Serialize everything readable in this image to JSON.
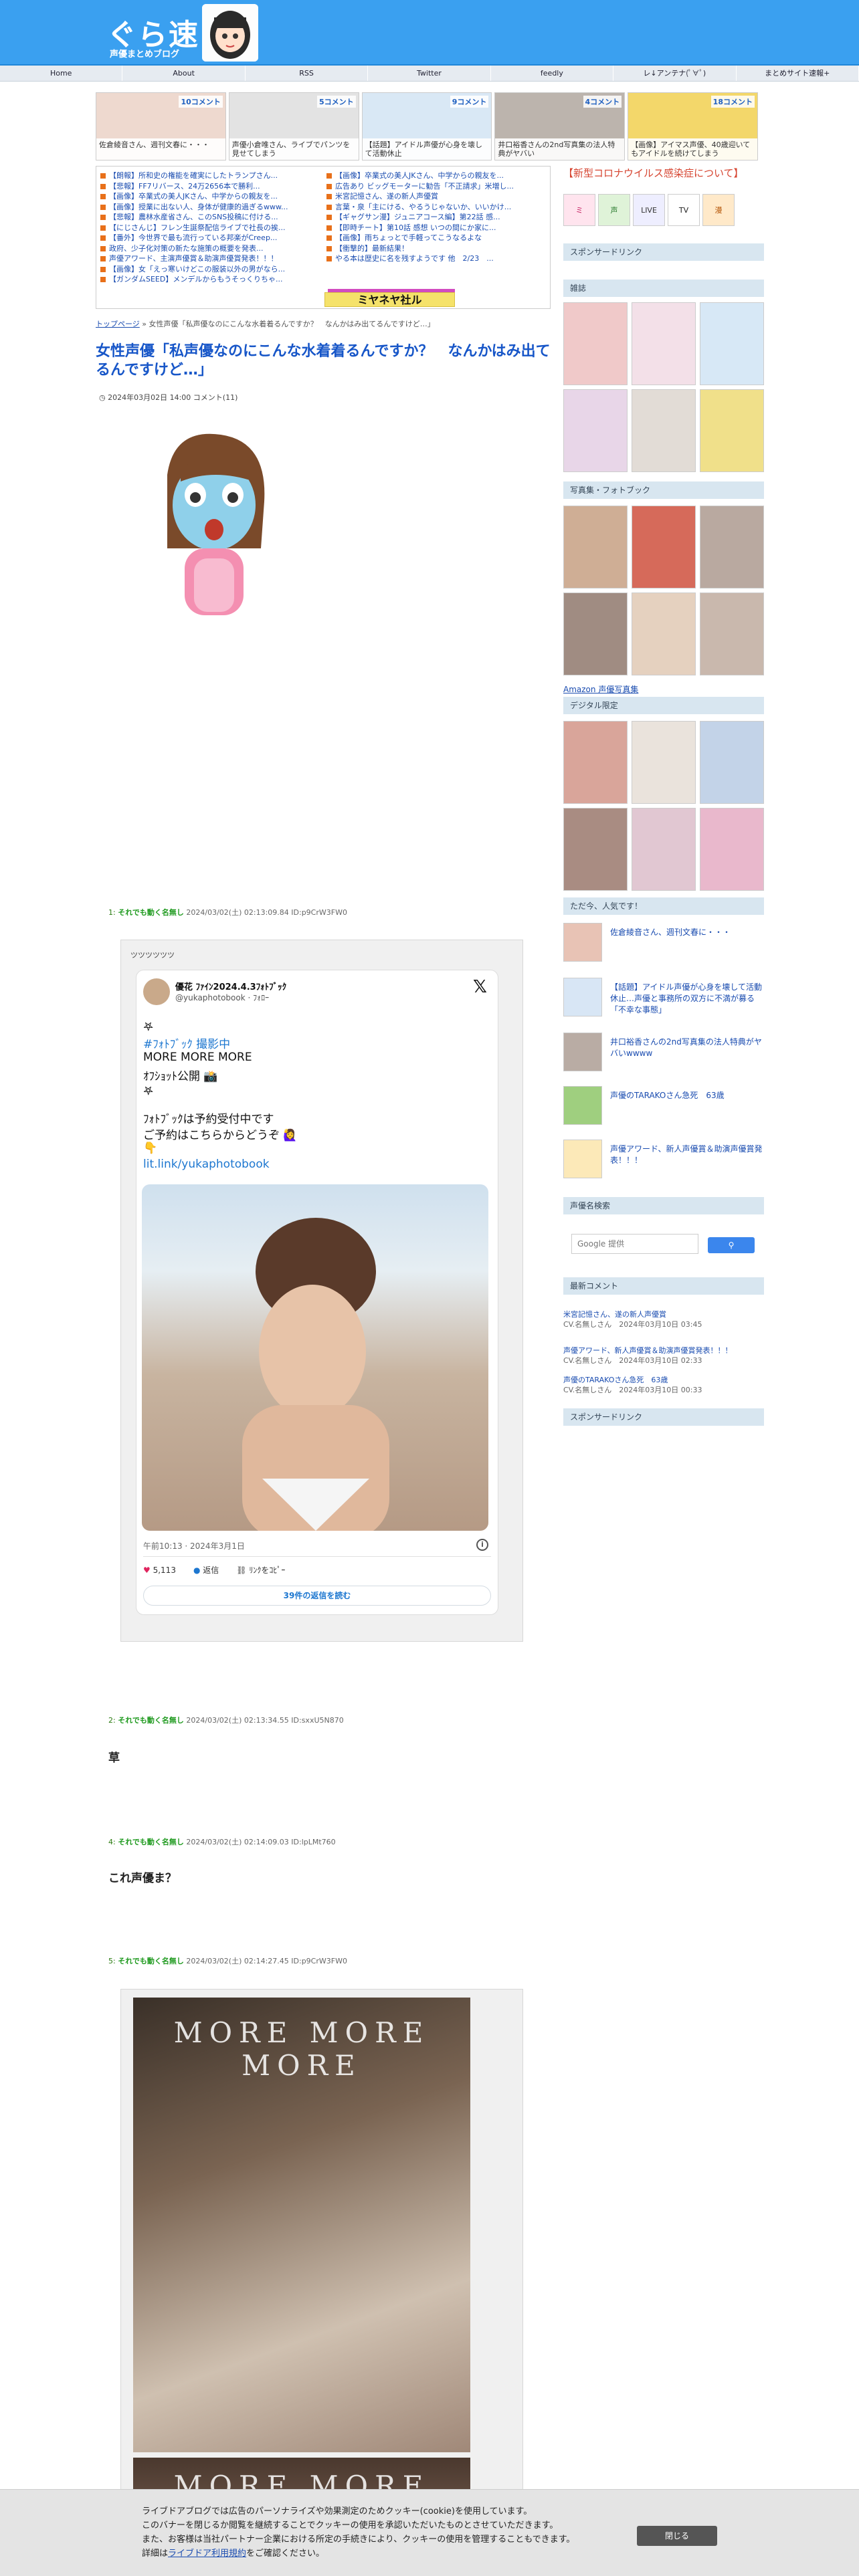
{
  "header": {
    "logo_main": "ぐら速",
    "logo_sub": "声優まとめブログ",
    "nav": [
      "Home",
      "About",
      "RSS",
      "Twitter",
      "feedly",
      "レ↓アンテナ(ﾟ∀ﾟ)",
      "まとめサイト速報+"
    ]
  },
  "top_thumbs": [
    {
      "comments": "10コメント",
      "caption": "佐倉綾音さん、週刊文春に・・・"
    },
    {
      "comments": "5コメント",
      "caption": "声優小倉唯さん、ライブでパンツを見せてしまう"
    },
    {
      "comments": "9コメント",
      "caption": "【話題】アイドル声優が心身を壊して活動休止"
    },
    {
      "comments": "4コメント",
      "caption": "井口裕香さんの2nd写真集の法人特典がヤバい"
    },
    {
      "comments": "18コメント",
      "caption": "【画像】アイマス声優、40歳迎いてもアイドルを続けてしまう"
    }
  ],
  "links_left": [
    "【朗報】所和史の権能を確実にしたトランプさん...",
    "【悲報】FF7リバース、24万2656本で勝利...",
    "【画像】卒業式の美人JKさん、中学からの親友を...",
    "【画像】授業に出ない人、身体が健康的過ぎるwww...",
    "【悲報】農林水産省さん、このSNS投稿に付ける...",
    "【にじさんじ】フレン生誕祭配信ライブで社長の挨...",
    "【番外】今世界で最も流行っている邦楽がCreep...",
    "政府、少子化対策の新たな施策の概要を発表...",
    "声優アワード、主演声優賞＆助演声優賞発表！！！",
    "【画像】女「えっ寒いけどこの服装以外の男がなら...",
    "【ガンダムSEED】メンデルからもうそっくりちゃ..."
  ],
  "links_right": [
    "【画像】卒業式の美人JKさん、中学からの親友を...",
    "広告あり ビッグモーターに勧告「不正請求」米増し...",
    "米宮記憶さん、遂の新人声優賞",
    "言葉・泉「主にける、やるうじゃないか、いいかけ...",
    "【ギャグサン漫】ジュニアコース編】第22話 感...",
    "【即時チート】第10話 感想 いつの間にか家に...",
    "【画像】雨ちょっとで手軽ってこうなるよな",
    "【衝撃的】最新結果！",
    "やる本は歴史に名を残すようです 他　2/23　..."
  ],
  "banner": "ミヤネヤ社ル",
  "breadcrumb": {
    "home": "トップページ",
    "sep": " » ",
    "current": "女性声優「私声優なのにこんな水着着るんですか？　なんかはみ出てるんですけど…」"
  },
  "post": {
    "title": "女性声優「私声優なのにこんな水着着るんですか？　なんかはみ出てるんですけど…」",
    "meta": "2024年03月02日 14:00 コメント(11)"
  },
  "comments": [
    {
      "num": "1:",
      "name": "それでも動く名無し",
      "date": "2024/03/02(土) 02:13:09.84",
      "id": "ID:p9CrW3FW0",
      "text": ""
    },
    {
      "num": "2:",
      "name": "それでも動く名無し",
      "date": "2024/03/02(土) 02:13:34.55",
      "id": "ID:sxxU5N870",
      "text": "草"
    },
    {
      "num": "4:",
      "name": "それでも動く名無し",
      "date": "2024/03/02(土) 02:14:09.03",
      "id": "ID:lpLMt760",
      "text": "これ声優ま？"
    },
    {
      "num": "5:",
      "name": "それでも動く名無し",
      "date": "2024/03/02(土) 02:14:27.45",
      "id": "ID:p9CrW3FW0",
      "text": ""
    }
  ],
  "embed_label": "ツツツツツツ",
  "tweet": {
    "name": "優花 ﾌｧｲﾝ2024.4.3ﾌｫﾄﾌﾞｯｸ",
    "handle": "@yukaphotobook · ﾌｫﾛｰ",
    "lines": [
      "𖤐",
      "#ﾌｫﾄﾌﾞｯｸ 撮影中",
      "MORE MORE MORE",
      "ｵﾌｼｮｯﾄ公開 📸",
      "𖤐",
      "ﾌｫﾄﾌﾞｯｸは予約受付中です",
      "ご予約はこちらからどうぞ 🙋‍♀️",
      "👇",
      "lit.link/yukaphotobook"
    ],
    "time": "午前10:13 · 2024年3月1日",
    "likes": "5,113",
    "reply": "返信",
    "share": "ﾘﾝｸをｺﾋﾟｰ",
    "read_more": "39件の返信を読む"
  },
  "photobook": {
    "title": "MORE MORE MORE"
  },
  "sidebar": {
    "red_text": "【新型コロナウイルス感染症について】",
    "icons": [
      "ミ",
      "声",
      "LIVE",
      "TV",
      "漫"
    ],
    "sponsored": "スポンサードリンク",
    "magazine": "雑誌",
    "photobook": "写真集・フォトブック",
    "amazon": "Amazon 声優写真集",
    "digital": "デジタル限定",
    "popular_head": "ただ今、人気です！",
    "popular": [
      "佐倉綾音さん、週刊文春に・・・",
      "【話題】アイドル声優が心身を壊して活動休止…声優と事務所の双方に不満が募る「不幸な事態」",
      "井口裕香さんの2nd写真集の法人特典がヤバいwwww",
      "声優のTARAKOさん急死　63歳",
      "声優アワード、新人声優賞＆助演声優賞発表！！！"
    ],
    "search_head": "声優名検索",
    "search_placeholder": "Google 提供",
    "recent_head": "最新コメント",
    "recent": [
      {
        "title": "米宮記憶さん、遂の新人声優賞",
        "meta": "CV.名無しさん　2024年03月10日 03:45"
      },
      {
        "title": "声優アワード、新人声優賞＆助演声優賞発表！！！",
        "meta": "CV.名無しさん　2024年03月10日 02:33"
      },
      {
        "title": "声優のTARAKOさん急死　63歳",
        "meta": "CV.名無しさん　2024年03月10日 00:33"
      }
    ],
    "sponsored2": "スポンサードリンク"
  },
  "cookie": {
    "line1": "ライブドアブログでは広告のパーソナライズや効果測定のためクッキー(cookie)を使用しています。",
    "line2": "このバナーを閉じるか閲覧を継続することでクッキーの使用を承認いただいたものとさせていただきます。",
    "line3": "また、お客様は当社パートナー企業における所定の手続きにより、クッキーの使用を管理することもできます。",
    "line4_pre": "詳細は",
    "line4_link": "ライブドア利用規約",
    "line4_post": "をご確認ください。",
    "button": "閉じる"
  },
  "colors": {
    "header": "#3aa0f0",
    "title": "#1756c8",
    "name_green": "#1f9a1f",
    "accent_orange": "#e8701a"
  }
}
